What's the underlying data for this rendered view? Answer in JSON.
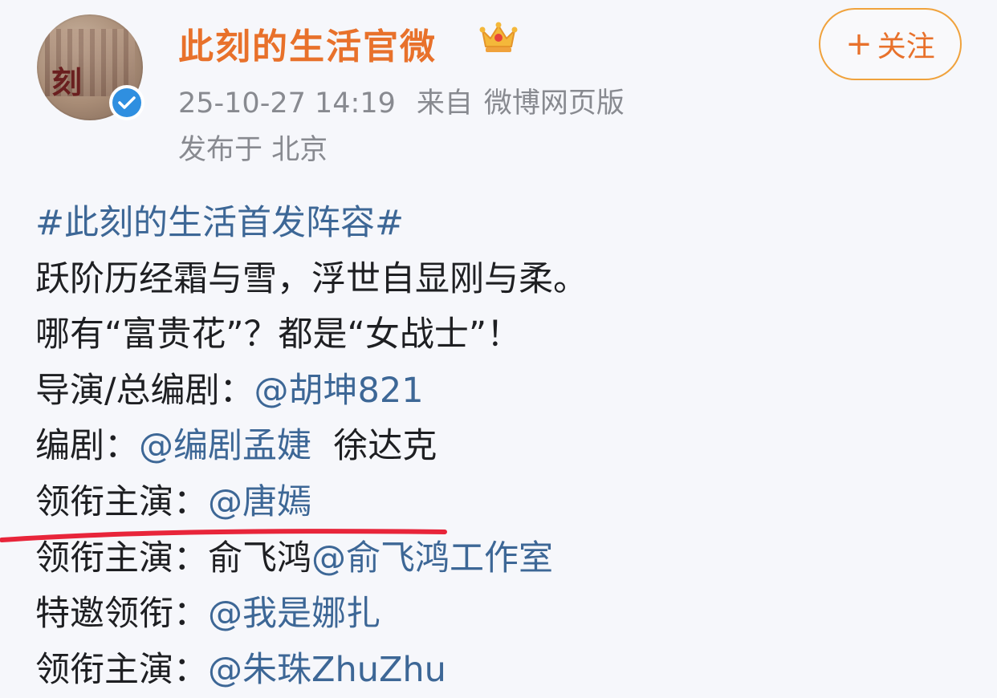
{
  "post": {
    "author": {
      "name": "此刻的生活官微",
      "avatar_label": "刻",
      "verified_icon": "verified-badge-icon",
      "crown_icon": "crown-icon"
    },
    "timestamp": "25-10-27 14:19",
    "source_prefix": "来自",
    "source": "微博网页版",
    "location": "发布于 北京",
    "follow_button": {
      "plus": "+",
      "label": "关注"
    }
  },
  "content": {
    "hashtag": "#此刻的生活首发阵容#",
    "line1": "跃阶历经霜与雪，浮世自显刚与柔。",
    "line2": "哪有“富贵花”？都是“女战士”！",
    "credits": [
      {
        "label": "导演/总编剧：",
        "mention": "@胡坤821",
        "extra": ""
      },
      {
        "label": "编剧：",
        "mention": "@编剧孟婕",
        "extra": "徐达克"
      },
      {
        "label": "领衔主演：",
        "mention": "@唐嫣",
        "extra": ""
      },
      {
        "label": "领衔主演：",
        "plain": "俞飞鸿",
        "mention": "@俞飞鸿工作室"
      },
      {
        "label": "特邀领衔：",
        "mention": "@我是娜扎",
        "extra": ""
      },
      {
        "label": "领衔主演：",
        "mention": "@朱珠ZhuZhu",
        "extra": ""
      }
    ]
  },
  "colors": {
    "name": "#e8712b",
    "link": "#3d6796",
    "meta": "#888a90",
    "follow_border": "#f0a23c",
    "annotation": "#e8253a"
  }
}
